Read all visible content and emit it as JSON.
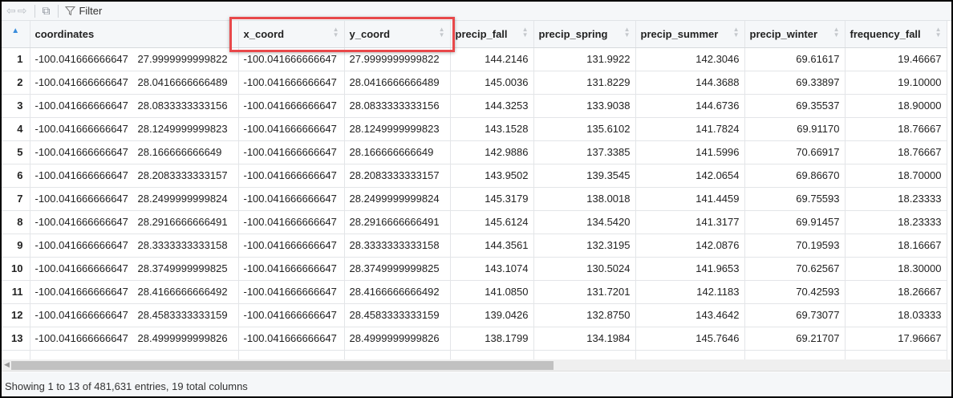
{
  "toolbar": {
    "back_icon": "arrow-left-icon",
    "forward_icon": "arrow-right-icon",
    "popout_icon": "popout-icon",
    "filter_label": "Filter"
  },
  "columns": [
    "coordinates",
    "x_coord",
    "y_coord",
    "precip_fall",
    "precip_spring",
    "precip_summer",
    "precip_winter",
    "frequency_fall"
  ],
  "sort_indicator": "▲",
  "highlight_color": "#e8484a",
  "rows": [
    {
      "n": "1",
      "c1": "-100.041666666647",
      "c2": "27.9999999999822",
      "x": "-100.041666666647",
      "y": "27.9999999999822",
      "pf": "144.2146",
      "ps": "131.9922",
      "pu": "142.3046",
      "pw": "69.61617",
      "ff": "19.46667"
    },
    {
      "n": "2",
      "c1": "-100.041666666647",
      "c2": "28.0416666666489",
      "x": "-100.041666666647",
      "y": "28.0416666666489",
      "pf": "145.0036",
      "ps": "131.8229",
      "pu": "144.3688",
      "pw": "69.33897",
      "ff": "19.10000"
    },
    {
      "n": "3",
      "c1": "-100.041666666647",
      "c2": "28.0833333333156",
      "x": "-100.041666666647",
      "y": "28.0833333333156",
      "pf": "144.3253",
      "ps": "133.9038",
      "pu": "144.6736",
      "pw": "69.35537",
      "ff": "18.90000"
    },
    {
      "n": "4",
      "c1": "-100.041666666647",
      "c2": "28.1249999999823",
      "x": "-100.041666666647",
      "y": "28.1249999999823",
      "pf": "143.1528",
      "ps": "135.6102",
      "pu": "141.7824",
      "pw": "69.91170",
      "ff": "18.76667"
    },
    {
      "n": "5",
      "c1": "-100.041666666647",
      "c2": "28.166666666649",
      "x": "-100.041666666647",
      "y": "28.166666666649",
      "pf": "142.9886",
      "ps": "137.3385",
      "pu": "141.5996",
      "pw": "70.66917",
      "ff": "18.76667"
    },
    {
      "n": "6",
      "c1": "-100.041666666647",
      "c2": "28.2083333333157",
      "x": "-100.041666666647",
      "y": "28.2083333333157",
      "pf": "143.9502",
      "ps": "139.3545",
      "pu": "142.0654",
      "pw": "69.86670",
      "ff": "18.70000"
    },
    {
      "n": "7",
      "c1": "-100.041666666647",
      "c2": "28.2499999999824",
      "x": "-100.041666666647",
      "y": "28.2499999999824",
      "pf": "145.3179",
      "ps": "138.0018",
      "pu": "141.4459",
      "pw": "69.75593",
      "ff": "18.23333"
    },
    {
      "n": "8",
      "c1": "-100.041666666647",
      "c2": "28.2916666666491",
      "x": "-100.041666666647",
      "y": "28.2916666666491",
      "pf": "145.6124",
      "ps": "134.5420",
      "pu": "141.3177",
      "pw": "69.91457",
      "ff": "18.23333"
    },
    {
      "n": "9",
      "c1": "-100.041666666647",
      "c2": "28.3333333333158",
      "x": "-100.041666666647",
      "y": "28.3333333333158",
      "pf": "144.3561",
      "ps": "132.3195",
      "pu": "142.0876",
      "pw": "70.19593",
      "ff": "18.16667"
    },
    {
      "n": "10",
      "c1": "-100.041666666647",
      "c2": "28.3749999999825",
      "x": "-100.041666666647",
      "y": "28.3749999999825",
      "pf": "143.1074",
      "ps": "130.5024",
      "pu": "141.9653",
      "pw": "70.62567",
      "ff": "18.30000"
    },
    {
      "n": "11",
      "c1": "-100.041666666647",
      "c2": "28.4166666666492",
      "x": "-100.041666666647",
      "y": "28.4166666666492",
      "pf": "141.0850",
      "ps": "131.7201",
      "pu": "142.1183",
      "pw": "70.42593",
      "ff": "18.26667"
    },
    {
      "n": "12",
      "c1": "-100.041666666647",
      "c2": "28.4583333333159",
      "x": "-100.041666666647",
      "y": "28.4583333333159",
      "pf": "139.0426",
      "ps": "132.8750",
      "pu": "143.4642",
      "pw": "69.73077",
      "ff": "18.03333"
    },
    {
      "n": "13",
      "c1": "-100.041666666647",
      "c2": "28.4999999999826",
      "x": "-100.041666666647",
      "y": "28.4999999999826",
      "pf": "138.1799",
      "ps": "134.1984",
      "pu": "145.7646",
      "pw": "69.21707",
      "ff": "17.96667"
    }
  ],
  "footer": {
    "status": "Showing 1 to 13 of 481,631 entries, 19 total columns"
  }
}
